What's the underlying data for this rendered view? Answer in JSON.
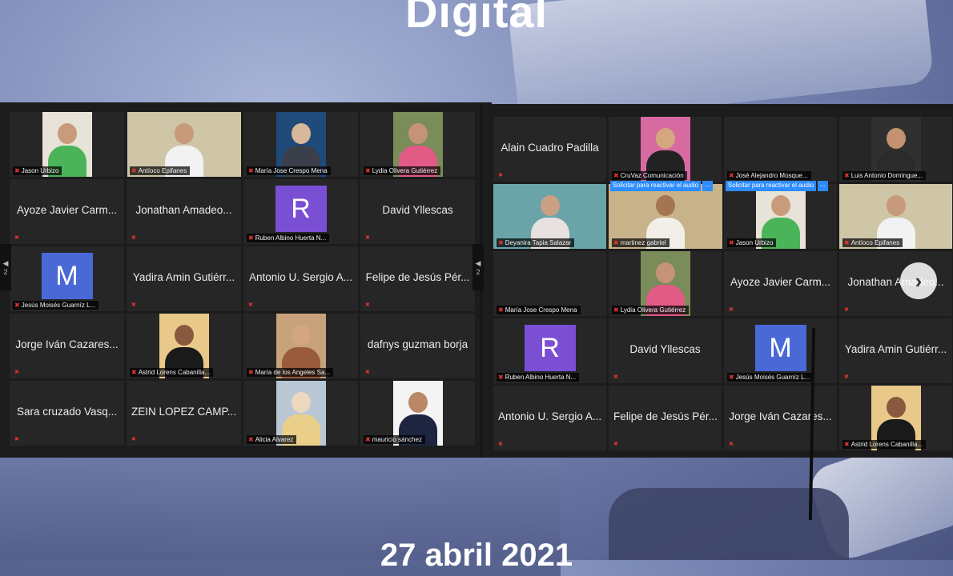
{
  "title": "Digital",
  "date": "27 abril 2021",
  "colors": {
    "tile_bg": "#262626",
    "avatar_purple": "#7b4fd4",
    "avatar_blue": "#4a69d6",
    "mic_red": "#e3342f",
    "audio_request_blue": "#2d8cff"
  },
  "left_panel": {
    "page_indicator": "2",
    "tiles": [
      {
        "type": "video",
        "label": "Jason Urbizo",
        "head": "#c99b7a",
        "body": "#4bb35a",
        "bg": "#e8e3d8"
      },
      {
        "type": "video",
        "label": "Antíoco Epifanes",
        "head": "#c79a7b",
        "body": "#f2f2f2",
        "bg": "#cfc5a7",
        "wide": true
      },
      {
        "type": "video",
        "label": "María Jose Crespo Mena",
        "head": "#d8b89a",
        "body": "#3a3f49",
        "bg": "#1f4a7a"
      },
      {
        "type": "video",
        "label": "Lydia Olivera Gutiérrez",
        "head": "#c59378",
        "body": "#e25a86",
        "bg": "#7a8c5a"
      },
      {
        "type": "name",
        "name": "Ayoze Javier Carm..."
      },
      {
        "type": "name",
        "name": "Jonathan Amadeo..."
      },
      {
        "type": "avatar",
        "letter": "R",
        "color": "#7b4fd4",
        "label": "Ruben Albino Huerta N..."
      },
      {
        "type": "name",
        "name": "David Yllescas"
      },
      {
        "type": "avatar",
        "letter": "M",
        "color": "#4a69d6",
        "label": "Jesús Moisés Guarníz L..."
      },
      {
        "type": "name",
        "name": "Yadira Amin Gutiérr..."
      },
      {
        "type": "name",
        "name": "Antonio U. Sergio A..."
      },
      {
        "type": "name",
        "name": "Felipe de Jesús Pér..."
      },
      {
        "type": "name",
        "name": "Jorge Iván Cazares..."
      },
      {
        "type": "video",
        "label": "Astrid Lorens Cabanilla...",
        "head": "#8a5a40",
        "body": "#1a1a1a",
        "bg": "#e9c98a"
      },
      {
        "type": "video",
        "label": "María de los Angeles Sa...",
        "head": "#d3a583",
        "body": "#9a5a3c",
        "bg": "#c7a27a"
      },
      {
        "type": "name",
        "name": "dafnys guzman borja"
      },
      {
        "type": "name",
        "name": "Sara cruzado Vasq..."
      },
      {
        "type": "name",
        "name": "ZEIN LOPEZ CAMP..."
      },
      {
        "type": "video",
        "label": "Alicia Alvarez",
        "head": "#ecd7bf",
        "body": "#e9cf8a",
        "bg": "#b9c7d4"
      },
      {
        "type": "video",
        "label": "mauricio sánchez",
        "head": "#b98866",
        "body": "#1d2541",
        "bg": "#f4f4f4"
      }
    ]
  },
  "right_panel": {
    "page_indicator": "2",
    "audio_request_label": "Solicitar para reactivar el audio",
    "audio_request_more": "...",
    "tiles": [
      {
        "type": "name",
        "name": "Alain Cuadro Padilla"
      },
      {
        "type": "video",
        "label": "CruVaz Comunicación",
        "head": "#d5a77f",
        "body": "#222222",
        "bg": "#d76aa0"
      },
      {
        "type": "blank",
        "label": "José Alejandro Mosque..."
      },
      {
        "type": "video",
        "label": "Luis Antonio Domíngue...",
        "head": "#c49270",
        "body": "#2b2b2b",
        "bg": "#303030"
      },
      {
        "type": "video",
        "label": "Deyanira Tapia Salazar",
        "head": "#caa084",
        "body": "#e7e2e0",
        "bg": "#6aa4a8",
        "wide": true
      },
      {
        "type": "video",
        "label": "martinez gabriel",
        "head": "#a57552",
        "body": "#f1efe8",
        "bg": "#c8b28a",
        "wide": true,
        "audio_request": true
      },
      {
        "type": "video",
        "label": "Jason Urbizo",
        "head": "#c99b7a",
        "body": "#4bb35a",
        "bg": "#e8e3d8",
        "audio_request": true
      },
      {
        "type": "video",
        "label": "Antíoco Epifanes",
        "head": "#c79a7b",
        "body": "#f2f2f2",
        "bg": "#cfc5a7",
        "wide": true
      },
      {
        "type": "blank",
        "label": "María Jose Crespo Mena"
      },
      {
        "type": "video",
        "label": "Lydia Olivera Gutiérrez",
        "head": "#c59378",
        "body": "#e25a86",
        "bg": "#7a8c5a"
      },
      {
        "type": "name",
        "name": "Ayoze Javier Carm..."
      },
      {
        "type": "name",
        "name": "Jonathan Amadeo..."
      },
      {
        "type": "avatar",
        "letter": "R",
        "color": "#7b4fd4",
        "label": "Ruben Albino Huerta N..."
      },
      {
        "type": "name",
        "name": "David Yllescas"
      },
      {
        "type": "avatar",
        "letter": "M",
        "color": "#4a69d6",
        "label": "Jesús Moisés Guarníz L..."
      },
      {
        "type": "name",
        "name": "Yadira Amin Gutiérr..."
      },
      {
        "type": "name",
        "name": "Antonio U. Sergio A..."
      },
      {
        "type": "name",
        "name": "Felipe de Jesús Pér..."
      },
      {
        "type": "name",
        "name": "Jorge Iván Cazares..."
      },
      {
        "type": "video",
        "label": "Astrid Lorens Cabanilla...",
        "head": "#8a5a40",
        "body": "#1a1a1a",
        "bg": "#e9c98a"
      }
    ]
  }
}
